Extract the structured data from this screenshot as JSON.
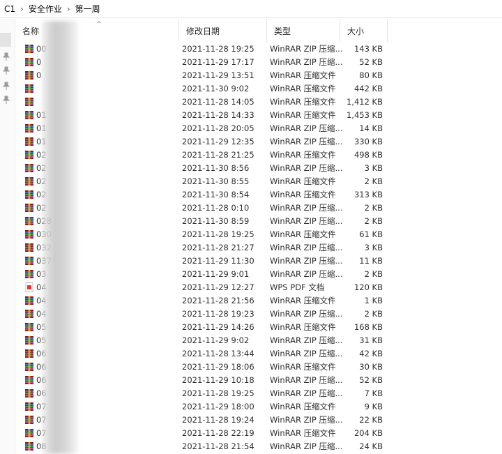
{
  "breadcrumb": [
    "C1",
    "安全作业",
    "第一周"
  ],
  "columns": {
    "name": "名称",
    "date": "修改日期",
    "type": "类型",
    "size": "大小"
  },
  "colors": {
    "rar_icon": "#8b1a1a",
    "pdf_icon": "#e0353a"
  },
  "files": [
    {
      "name": "00",
      "date": "2021-11-28 19:25",
      "type": "WinRAR ZIP 压缩...",
      "size": "143 KB",
      "icon": "rar-archive-icon"
    },
    {
      "name": "0",
      "date": "2021-11-29 17:17",
      "type": "WinRAR ZIP 压缩...",
      "size": "52 KB",
      "icon": "rar-archive-icon"
    },
    {
      "name": "0",
      "date": "2021-11-29 13:51",
      "type": "WinRAR 压缩文件",
      "size": "80 KB",
      "icon": "rar-archive-icon"
    },
    {
      "name": "",
      "date": "2021-11-30 9:02",
      "type": "WinRAR 压缩文件",
      "size": "442 KB",
      "icon": "rar-archive-icon"
    },
    {
      "name": "",
      "date": "2021-11-28 14:05",
      "type": "WinRAR 压缩文件",
      "size": "1,412 KB",
      "icon": "rar-archive-icon"
    },
    {
      "name": "01",
      "date": "2021-11-28 14:33",
      "type": "WinRAR 压缩文件",
      "size": "1,453 KB",
      "icon": "rar-archive-icon"
    },
    {
      "name": "01",
      "date": "2021-11-28 20:05",
      "type": "WinRAR ZIP 压缩...",
      "size": "14 KB",
      "icon": "rar-archive-icon"
    },
    {
      "name": "01",
      "date": "2021-11-29 12:35",
      "type": "WinRAR ZIP 压缩...",
      "size": "330 KB",
      "icon": "rar-archive-icon"
    },
    {
      "name": "02",
      "date": "2021-11-28 21:25",
      "type": "WinRAR 压缩文件",
      "size": "498 KB",
      "icon": "rar-archive-icon"
    },
    {
      "name": "02",
      "date": "2021-11-30 8:56",
      "type": "WinRAR ZIP 压缩...",
      "size": "3 KB",
      "icon": "rar-archive-icon"
    },
    {
      "name": "02",
      "date": "2021-11-30 8:55",
      "type": "WinRAR 压缩文件",
      "size": "2 KB",
      "icon": "rar-archive-icon"
    },
    {
      "name": "02",
      "date": "2021-11-30 8:54",
      "type": "WinRAR 压缩文件",
      "size": "313 KB",
      "icon": "rar-archive-icon"
    },
    {
      "name": "02",
      "date": "2021-11-28 0:10",
      "type": "WinRAR ZIP 压缩...",
      "size": "2 KB",
      "icon": "rar-archive-icon"
    },
    {
      "name": "028",
      "date": "2021-11-30 8:59",
      "type": "WinRAR ZIP 压缩...",
      "size": "2 KB",
      "icon": "rar-archive-icon"
    },
    {
      "name": "030",
      "date": "2021-11-28 19:25",
      "type": "WinRAR 压缩文件",
      "size": "61 KB",
      "icon": "rar-archive-icon"
    },
    {
      "name": "032",
      "date": "2021-11-28 21:27",
      "type": "WinRAR ZIP 压缩...",
      "size": "3 KB",
      "icon": "rar-archive-icon"
    },
    {
      "name": "037",
      "date": "2021-11-29 11:30",
      "type": "WinRAR ZIP 压缩...",
      "size": "11 KB",
      "icon": "rar-archive-icon"
    },
    {
      "name": "03",
      "date": "2021-11-29 9:01",
      "type": "WinRAR ZIP 压缩...",
      "size": "2 KB",
      "icon": "rar-archive-icon"
    },
    {
      "name": "04",
      "date": "2021-11-29 12:27",
      "type": "WPS PDF 文档",
      "size": "120 KB",
      "icon": "pdf-file-icon"
    },
    {
      "name": "04",
      "date": "2021-11-28 21:56",
      "type": "WinRAR 压缩文件",
      "size": "1 KB",
      "icon": "rar-archive-icon"
    },
    {
      "name": "04",
      "date": "2021-11-28 19:23",
      "type": "WinRAR ZIP 压缩...",
      "size": "2 KB",
      "icon": "rar-archive-icon"
    },
    {
      "name": "05",
      "date": "2021-11-29 14:26",
      "type": "WinRAR 压缩文件",
      "size": "168 KB",
      "icon": "rar-archive-icon"
    },
    {
      "name": "05",
      "date": "2021-11-29 9:02",
      "type": "WinRAR ZIP 压缩...",
      "size": "31 KB",
      "icon": "rar-archive-icon"
    },
    {
      "name": "06",
      "date": "2021-11-28 13:44",
      "type": "WinRAR ZIP 压缩...",
      "size": "42 KB",
      "icon": "rar-archive-icon"
    },
    {
      "name": "06",
      "date": "2021-11-29 18:06",
      "type": "WinRAR 压缩文件",
      "size": "30 KB",
      "icon": "rar-archive-icon"
    },
    {
      "name": "06",
      "date": "2021-11-29 10:18",
      "type": "WinRAR ZIP 压缩...",
      "size": "52 KB",
      "icon": "rar-archive-icon"
    },
    {
      "name": "06",
      "date": "2021-11-28 19:25",
      "type": "WinRAR ZIP 压缩...",
      "size": "7 KB",
      "icon": "rar-archive-icon"
    },
    {
      "name": "07",
      "date": "2021-11-29 18:00",
      "type": "WinRAR 压缩文件",
      "size": "9 KB",
      "icon": "rar-archive-icon"
    },
    {
      "name": "07",
      "date": "2021-11-28 19:24",
      "type": "WinRAR ZIP 压缩...",
      "size": "22 KB",
      "icon": "rar-archive-icon"
    },
    {
      "name": "07",
      "date": "2021-11-28 22:19",
      "type": "WinRAR 压缩文件",
      "size": "204 KB",
      "icon": "rar-archive-icon"
    },
    {
      "name": "08",
      "date": "2021-11-28 21:54",
      "type": "WinRAR ZIP 压缩...",
      "size": "24 KB",
      "icon": "rar-archive-icon"
    }
  ]
}
